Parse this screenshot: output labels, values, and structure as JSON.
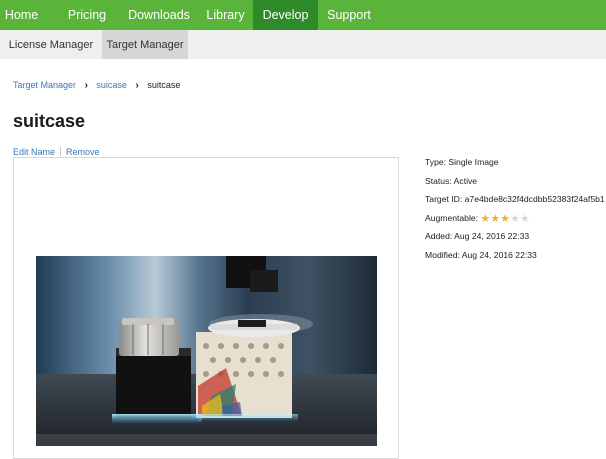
{
  "topnav": {
    "items": [
      {
        "label": "Home"
      },
      {
        "label": "Pricing"
      },
      {
        "label": "Downloads"
      },
      {
        "label": "Library"
      },
      {
        "label": "Develop"
      },
      {
        "label": "Support"
      }
    ],
    "active": "Develop"
  },
  "subnav": {
    "items": [
      {
        "label": "License Manager"
      },
      {
        "label": "Target Manager"
      }
    ],
    "active": "Target Manager"
  },
  "breadcrumb": {
    "items": [
      "Target Manager",
      "suicase",
      "suitcase"
    ],
    "separator": "›"
  },
  "page": {
    "title": "suitcase"
  },
  "actions": {
    "edit_label": "Edit Name",
    "remove_label": "Remove"
  },
  "target": {
    "type": "Type: Single Image",
    "status": "Status: Active",
    "target_id": "Target ID: a7e4bde8c32f4dcdbb52383f24af5b1",
    "augmentable_label": "Augmentable:",
    "augmentable_rating": 3,
    "augmentable_max": 5,
    "added": "Added: Aug 24, 2016 22:33",
    "modified": "Modified: Aug 24, 2016 22:33"
  },
  "colors": {
    "nav_bg": "#5ab43a",
    "nav_active": "#2f8a2a",
    "subnav_bg": "#efefef",
    "subnav_active": "#d6d6d6",
    "link": "#3a78b6",
    "star_on": "#f2b134",
    "star_off": "#d8d8d8"
  }
}
